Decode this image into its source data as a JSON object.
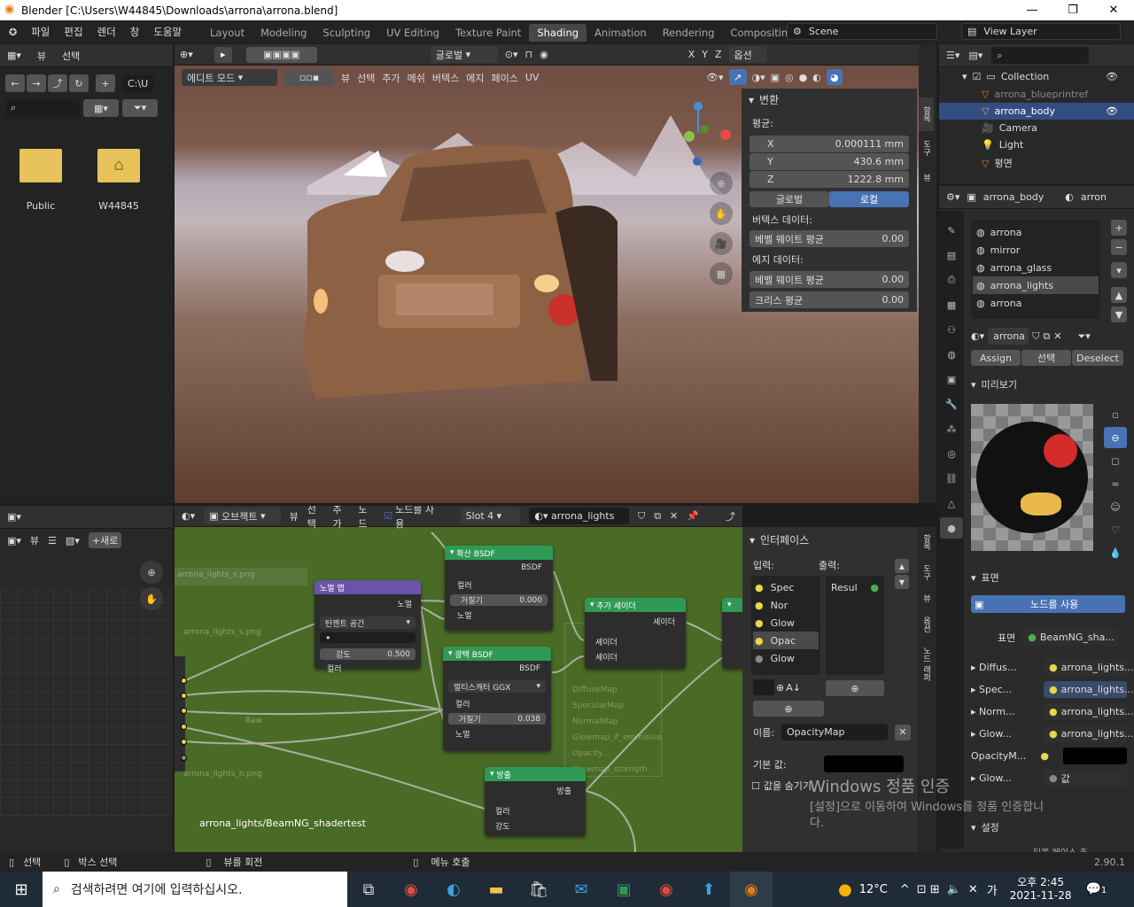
{
  "window": {
    "title": "Blender [C:\\Users\\W44845\\Downloads\\arrona\\arrona.blend]"
  },
  "menu": [
    "파일",
    "편집",
    "렌더",
    "창",
    "도움말"
  ],
  "workspaces": [
    "Layout",
    "Modeling",
    "Sculpting",
    "UV Editing",
    "Texture Paint",
    "Shading",
    "Animation",
    "Rendering",
    "Compositing",
    "Sc"
  ],
  "scene": "Scene",
  "view_layer": "View Layer",
  "filebrowser": {
    "header": [
      "뷰",
      "선택"
    ],
    "path": "C:\\U",
    "items": [
      {
        "name": "Public"
      },
      {
        "name": "W44845"
      }
    ]
  },
  "viewport": {
    "mode": "에디트 모드",
    "menu": [
      "뷰",
      "선택",
      "추가",
      "메쉬",
      "버텍스",
      "에지",
      "페이스",
      "UV"
    ],
    "orientation": "글로벌",
    "options": "옵션",
    "axes": [
      "X",
      "Y",
      "Z"
    ]
  },
  "transform": {
    "title": "변환",
    "median_label": "평균:",
    "x": {
      "label": "X",
      "value": "0.000111 mm"
    },
    "y": {
      "label": "Y",
      "value": "430.6 mm"
    },
    "z": {
      "label": "Z",
      "value": "1222.8 mm"
    },
    "global": "글로벌",
    "local": "로컬",
    "vertex_data": "버텍스 데이터:",
    "vertex_bevel": "베벨 웨이트 평균",
    "vertex_bevel_val": "0.00",
    "edge_data": "에지 데이터:",
    "edge_bevel": "베벨 웨이트 평균",
    "edge_bevel_val": "0.00",
    "crease": "크리스 평균",
    "crease_val": "0.00"
  },
  "side_tabs_viewport": [
    "항목",
    "도구",
    "뷰"
  ],
  "outliner": {
    "collection": "Collection",
    "items": [
      {
        "name": "arrona_blueprintref"
      },
      {
        "name": "arrona_body"
      },
      {
        "name": "Camera"
      },
      {
        "name": "Light"
      },
      {
        "name": "평면"
      }
    ]
  },
  "properties": {
    "object": "arrona_body",
    "material_short": "arron",
    "slots": [
      "arrona",
      "mirror",
      "arrona_glass",
      "arrona_lights",
      "arrona"
    ],
    "material_field": "arrona",
    "assign": "Assign",
    "select": "선택",
    "deselect": "Deselect",
    "preview": "미리보기",
    "surface": "표면",
    "use_nodes": "노드를 사용",
    "surface_label": "표면",
    "surface_value": "BeamNG_sha...",
    "inputs": [
      {
        "label": "Diffus...",
        "value": "arrona_lights..."
      },
      {
        "label": "Spec...",
        "value": "arrona_lights..."
      },
      {
        "label": "Norm...",
        "value": "arrona_lights..."
      },
      {
        "label": "Glow...",
        "value": "arrona_lights..."
      },
      {
        "label": "OpacityM...",
        "value": ""
      },
      {
        "label": "Glow...",
        "value": "값"
      }
    ],
    "settings": "설정",
    "bottom_cut": "뒤쪽 페이스 추..."
  },
  "image_editor": {
    "view": "뷰",
    "new": "새로"
  },
  "node_editor": {
    "object": "오브젝트",
    "menu": [
      "뷰",
      "선택",
      "추가",
      "노드"
    ],
    "use_nodes": "노드를 사용",
    "slot": "Slot 4",
    "material": "arrona_lights",
    "breadcrumb": "arrona_lights/BeamNG_shadertest"
  },
  "nodes": {
    "normal_map": {
      "title": "노멀 맵",
      "out": "노멀",
      "space": "탄젠트 공간",
      "strength": "강도",
      "strength_val": "0.500",
      "color": "컬러"
    },
    "diffuse": {
      "title": "확산 BSDF",
      "out": "BSDF",
      "color": "컬러",
      "rough": "거칠기",
      "rough_val": "0.000",
      "normal": "노멀"
    },
    "glossy": {
      "title": "광택 BSDF",
      "out": "BSDF",
      "dist": "멀티스캐터 GGX",
      "color": "컬러",
      "rough": "거칠기",
      "rough_val": "0.038",
      "normal": "노멀"
    },
    "add": {
      "title": "추가 셰이더",
      "out": "셰이더",
      "in1": "셰이더",
      "in2": "셰이더"
    },
    "emission": {
      "title": "방출",
      "out": "방출",
      "color": "컬러",
      "strength": "강도"
    },
    "ghost": [
      "DiffuseMap",
      "SpecularMap",
      "NormalMap",
      "Glowmap_if_emmisive",
      "Opacity...",
      "Glowmap_strength"
    ],
    "ghost_img1": "arrona_lights_s.png",
    "ghost_img2": "arrona_lights_n.png",
    "ghost_raw": "Raw"
  },
  "interface": {
    "title": "인터페이스",
    "inputs_label": "입력:",
    "outputs_label": "출력:",
    "inputs": [
      "Spec",
      "Nor",
      "Glow",
      "Opac",
      "Glow"
    ],
    "outputs": [
      "Resul"
    ],
    "name_label": "이름:",
    "name_value": "OpacityMap",
    "default_label": "기본 값:",
    "hide_label": "값을 숨기기"
  },
  "side_tabs_node": [
    "항목",
    "도구",
    "뷰",
    "옵션",
    "노드 래퍼"
  ],
  "statusbar": {
    "select": "선택",
    "box_select": "박스 선택",
    "rotate": "뷰를 회전",
    "call_menu": "메뉴 호출",
    "version": "2.90.1"
  },
  "watermark": {
    "line1": "Windows 정품 인증",
    "line2": "[설정]으로 이동하여 Windows를 정품 인증합니",
    "line3": "다."
  },
  "taskbar": {
    "search": "검색하려면 여기에 입력하십시오.",
    "temp": "12°C",
    "ime": "가",
    "time": "오후 2:45",
    "date": "2021-11-28",
    "notif": "1"
  },
  "colors": {
    "accent": "#4772b3",
    "node_bg": "#4a6b26",
    "viewport_tint": "#7a5a4a"
  }
}
